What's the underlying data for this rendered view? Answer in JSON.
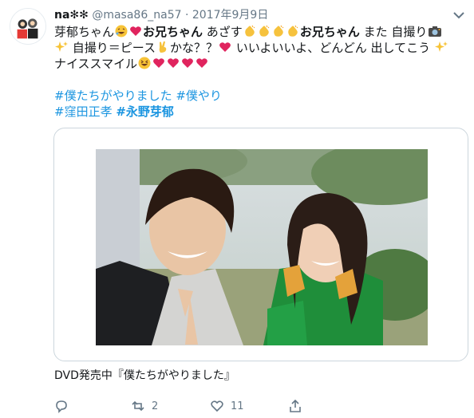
{
  "tweet": {
    "display_name": "na",
    "name_suffix": "✻✻",
    "handle": "@masa86_na57",
    "separator": "·",
    "date": "2017年9月9日",
    "body": {
      "line1": [
        {
          "t": "芽郁ちゃん"
        },
        {
          "emoji": "laugh-emoji"
        },
        {
          "emoji": "heart-emoji"
        },
        {
          "t": "お兄ちゃん",
          "b": true
        },
        {
          "t": " あざす"
        },
        {
          "emoji": "clap-emoji"
        },
        {
          "emoji": "clap-emoji"
        },
        {
          "emoji": "clap-emoji"
        },
        {
          "emoji": "clap-emoji"
        },
        {
          "t": "お兄ちゃん",
          "b": true
        },
        {
          "t": " また 自撮り"
        },
        {
          "emoji": "camera-emoji"
        }
      ],
      "line2": [
        {
          "emoji": "sparkles-emoji"
        },
        {
          "t": " 自撮り＝ピース"
        },
        {
          "emoji": "victory-hand-emoji"
        },
        {
          "t": "かな？？"
        },
        {
          "emoji": "heart-emoji"
        },
        {
          "t": " いいよいいよ、どんどん 出してこう "
        },
        {
          "emoji": "sparkles-emoji"
        }
      ],
      "line3": [
        {
          "t": "ナイススマイル"
        },
        {
          "emoji": "grin-emoji"
        },
        {
          "emoji": "heart-emoji"
        },
        {
          "emoji": "heart-emoji"
        },
        {
          "emoji": "heart-emoji"
        },
        {
          "emoji": "heart-emoji"
        }
      ]
    },
    "hashtags_row1": [
      "#僕たちがやりました",
      "#僕やり"
    ],
    "hashtags_row2": [
      "#窪田正孝",
      "#永野芽郁"
    ],
    "caption": "DVD発売中『僕たちがやりました』",
    "actions": {
      "reply_count": "",
      "retweet_count": "2",
      "like_count": "11"
    },
    "colors": {
      "link": "#1b95e0",
      "muted": "#657786",
      "text": "#14171a",
      "border": "#ccd6dd"
    }
  }
}
